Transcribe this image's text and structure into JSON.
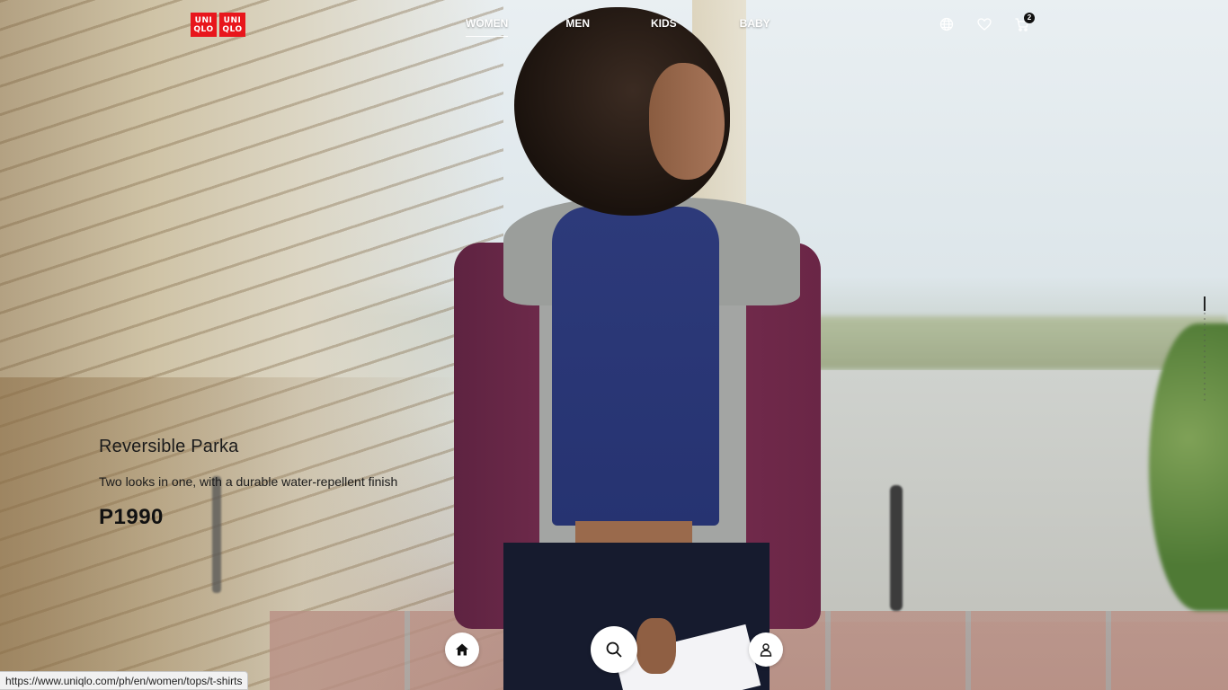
{
  "brand": {
    "logo_left_top": "UNI",
    "logo_left_bottom": "QLO",
    "logo_right_top": "UNI",
    "logo_right_bottom": "QLO",
    "color": "#e8161c"
  },
  "nav": {
    "items": [
      {
        "label": "WOMEN",
        "active": true
      },
      {
        "label": "MEN",
        "active": false
      },
      {
        "label": "KIDS",
        "active": false
      },
      {
        "label": "BABY",
        "active": false
      }
    ]
  },
  "header_icons": {
    "language": "globe-icon",
    "wishlist": "heart-icon",
    "cart": "cart-icon",
    "cart_count": "2"
  },
  "hero": {
    "product_name": "Reversible Parka",
    "product_description": "Two looks in one, with a durable water-repellent finish",
    "price": "P1990",
    "slide_progress": 0.13
  },
  "bottom_bar": {
    "home": "home-icon",
    "search": "search-icon",
    "account": "user-icon"
  },
  "status_bar": {
    "url": "https://www.uniqlo.com/ph/en/women/tops/t-shirts"
  }
}
